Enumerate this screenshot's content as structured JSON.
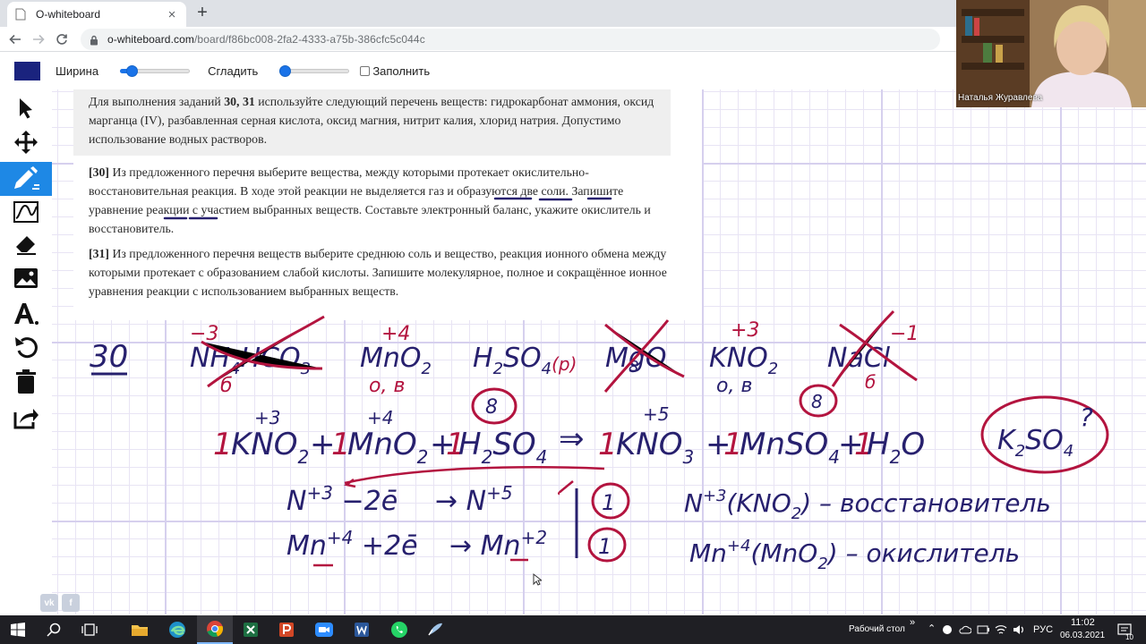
{
  "browser": {
    "tab_title": "O-whiteboard",
    "url_host": "o-whiteboard.com",
    "url_path": "/board/f86bc008-2fa2-4333-a75b-386cfc5c044c",
    "icons": [
      "back-icon",
      "forward-icon",
      "reload-icon",
      "lock-icon",
      "close-icon",
      "plus-icon"
    ]
  },
  "whiteboard": {
    "toolbar": {
      "pen_color": "#1a237e",
      "width_label": "Ширина",
      "width_value": 0.17,
      "smooth_label": "Сгладить",
      "smooth_value": 0.02,
      "fill_label": "Заполнить",
      "fill_checked": false
    },
    "tools": [
      "pointer-icon",
      "move-icon",
      "pen-icon",
      "line-tool-icon",
      "eraser-icon",
      "image-icon",
      "text-tool-icon",
      "undo-icon",
      "trash-icon",
      "export-icon"
    ],
    "active_tool": "pen-icon",
    "accent_color": "#1e88e5",
    "ink_colors": {
      "navy": "#27206e",
      "crimson": "#b3143f"
    }
  },
  "task": {
    "intro_pre": "Для выполнения заданий ",
    "intro_bold": "30, 31",
    "intro_post": " используйте следующий перечень веществ: гидрокарбонат аммония, оксид марганца (IV), разбавленная серная кислота, оксид магния, нитрит калия, хлорид натрия. Допустимо использование водных растворов.",
    "q30_num": "[30]",
    "q30_text": " Из предложенного перечня выберите вещества, между которыми протекает окислительно-восстановительная реакция. В ходе этой реакции не выделяется газ и образуются две соли. Запишите уравнение реакции с участием выбранных веществ. Составьте электронный баланс, укажите окислитель и восстановитель.",
    "q31_num": "[31]",
    "q31_text": " Из предложенного перечня веществ выберите среднюю соль и вещество, реакция ионного обмена между которыми протекает с образованием слабой кислоты. Запишите молекулярное, полное и сокращённое ионное уравнения реакции с использованием выбранных веществ."
  },
  "handwriting": {
    "task_number": "30",
    "substances": [
      {
        "formula": "NH4HCO3",
        "oxidation": "-3",
        "note": "б",
        "crossed": true
      },
      {
        "formula": "MnO2",
        "oxidation": "+4",
        "note": "о, в",
        "crossed": false
      },
      {
        "formula": "H2SO4(р)",
        "oxidation": "",
        "note": "8",
        "crossed": false
      },
      {
        "formula": "MgO",
        "oxidation": "",
        "note": "8",
        "crossed": true
      },
      {
        "formula": "KNO2",
        "oxidation": "+3",
        "note": "о, в",
        "crossed": false
      },
      {
        "formula": "NaCl",
        "oxidation": "-1",
        "note": "б",
        "crossed": true
      }
    ],
    "equation": "1KNO2 + 1MnO2 + 1H2SO4 → 1KNO3 + 1MnSO4 + 1H2O",
    "side_note": "K2SO4 ?",
    "balance": [
      {
        "half": "N+3 − 2e → N+5",
        "coef": "1"
      },
      {
        "half": "Mn+4 + 2e → Mn+2",
        "coef": "1"
      }
    ],
    "roles": [
      {
        "text": "N+3 (KNO2) – восстановитель"
      },
      {
        "text": "Mn+4 (MnO2) – окислитель"
      }
    ]
  },
  "social": {
    "vk": "vk",
    "fb": "f"
  },
  "webcam": {
    "name": "Наталья Журавлева"
  },
  "taskbar": {
    "apps": [
      "windows-start-icon",
      "search-icon",
      "task-view-icon",
      "file-explorer-icon",
      "edge-icon",
      "chrome-icon",
      "excel-icon",
      "powerpoint-icon",
      "zoom-icon",
      "word-icon",
      "whatsapp-icon",
      "paint-icon"
    ],
    "desktop_label": "Рабочий стол",
    "lang": "РУС",
    "time": "11:02",
    "date": "06.03.2021",
    "notifications": "10"
  }
}
